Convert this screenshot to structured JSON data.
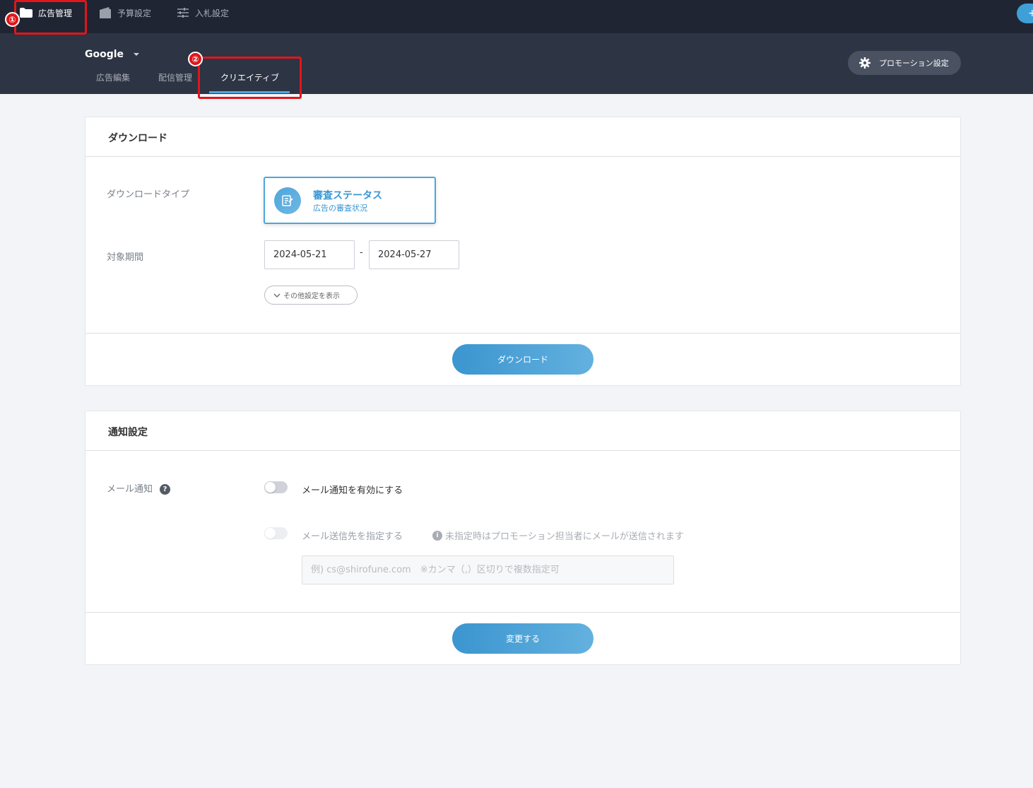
{
  "topnav": {
    "items": [
      {
        "label": "広告管理",
        "icon": "folder-icon",
        "active": true
      },
      {
        "label": "予算設定",
        "icon": "wallet-icon",
        "active": false
      },
      {
        "label": "入札設定",
        "icon": "sliders-icon",
        "active": false
      }
    ],
    "fab_label": "+"
  },
  "subheader": {
    "provider": "Google",
    "tabs": [
      {
        "label": "広告編集",
        "active": false
      },
      {
        "label": "配信管理",
        "active": false
      },
      {
        "label": "クリエイティブ",
        "active": true
      }
    ],
    "promotion_settings_label": "プロモーション設定"
  },
  "annotations": {
    "badge_1": "①",
    "badge_2": "②"
  },
  "download": {
    "title": "ダウンロード",
    "type_label": "ダウンロードタイプ",
    "type_option": {
      "title": "審査ステータス",
      "subtitle": "広告の審査状況",
      "icon": "edit-document-icon",
      "selected": true
    },
    "period_label": "対象期間",
    "date_from": "2024-05-21",
    "date_separator": "-",
    "date_to": "2024-05-27",
    "more_settings_label": "その他設定を表示",
    "download_button": "ダウンロード"
  },
  "notification": {
    "title": "通知設定",
    "email_label": "メール通知",
    "help_icon": "?",
    "enable_toggle": {
      "label": "メール通知を有効にする",
      "on": false
    },
    "recipient_toggle": {
      "label": "メール送信先を指定する",
      "on": false,
      "disabled": true
    },
    "hint_icon": "i",
    "hint": "未指定時はプロモーション担当者にメールが送信されます",
    "email_placeholder": "例) cs@shirofune.com　※カンマ（,）区切りで複数指定可",
    "change_button": "変更する"
  },
  "colors": {
    "topnav_bg": "#1f2533",
    "subheader_bg": "#2d3443",
    "accent": "#4da6dc",
    "annotation": "#e0161a"
  }
}
